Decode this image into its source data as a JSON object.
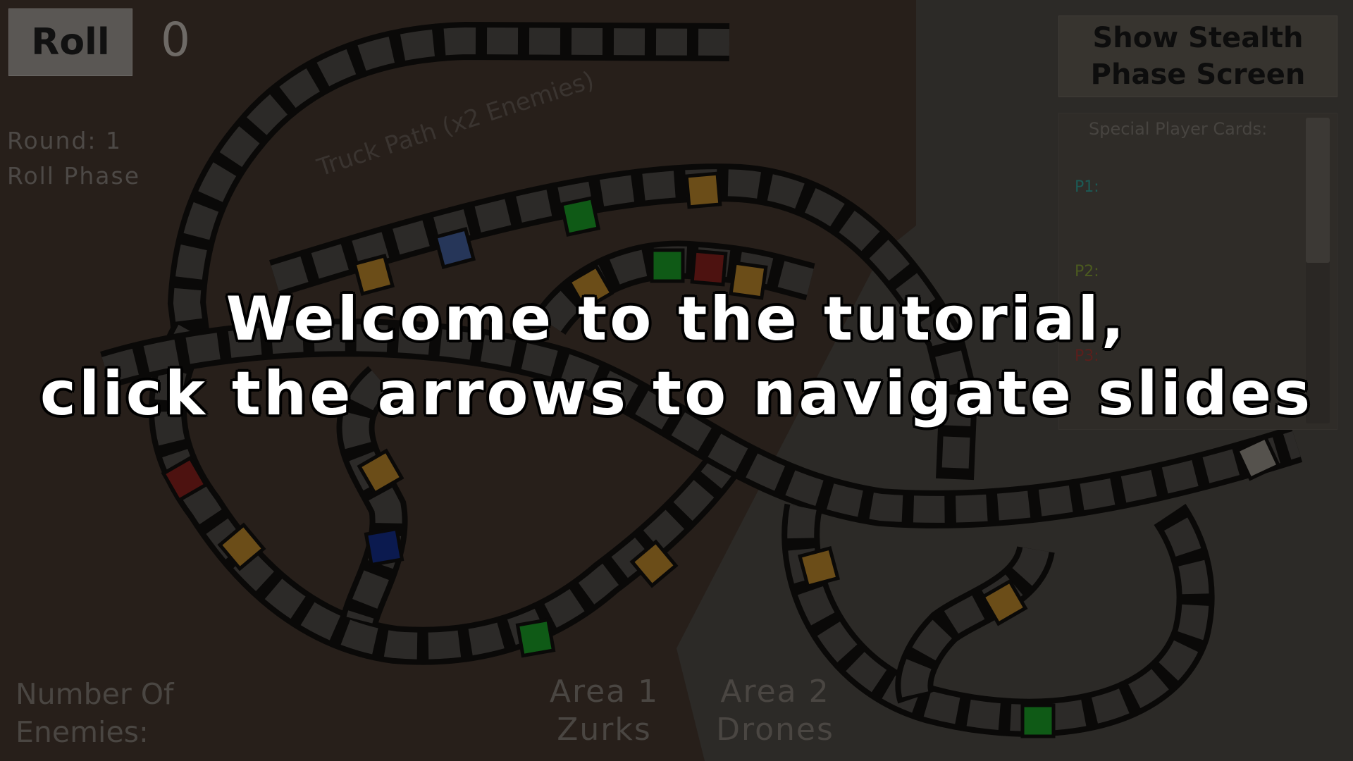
{
  "hud": {
    "roll_label": "Roll",
    "roll_value": "0",
    "round_label": "Round: 1",
    "phase_label": "Roll Phase",
    "stealth_button_line1": "Show Stealth",
    "stealth_button_line2": "Phase Screen"
  },
  "cards_panel": {
    "title": "Special Player Cards:",
    "players": [
      {
        "label": "P1:",
        "color": "#1c5a55"
      },
      {
        "label": "P2:",
        "color": "#4b5a1f"
      },
      {
        "label": "P3:",
        "color": "#5a1f1c"
      }
    ]
  },
  "board": {
    "truck_path_label": "Truck Path (x2 Enemies)",
    "empty_tile_color": "#2c2a28",
    "tile_colors": {
      "orange": "#6b4d18",
      "green": "#0f5a16",
      "blue": "#263659",
      "dark_blue": "#0b1a4f",
      "red": "#4d1210",
      "exit": "#55524d"
    }
  },
  "footer": {
    "enemies_line1": "Number Of",
    "enemies_line2": "Enemies:",
    "area1_line1": "Area 1",
    "area1_line2": "Zurks",
    "area2_line1": "Area 2",
    "area2_line2": "Drones"
  },
  "tutorial": {
    "line1": "Welcome to the tutorial,",
    "line2": "click the arrows to navigate slides"
  }
}
